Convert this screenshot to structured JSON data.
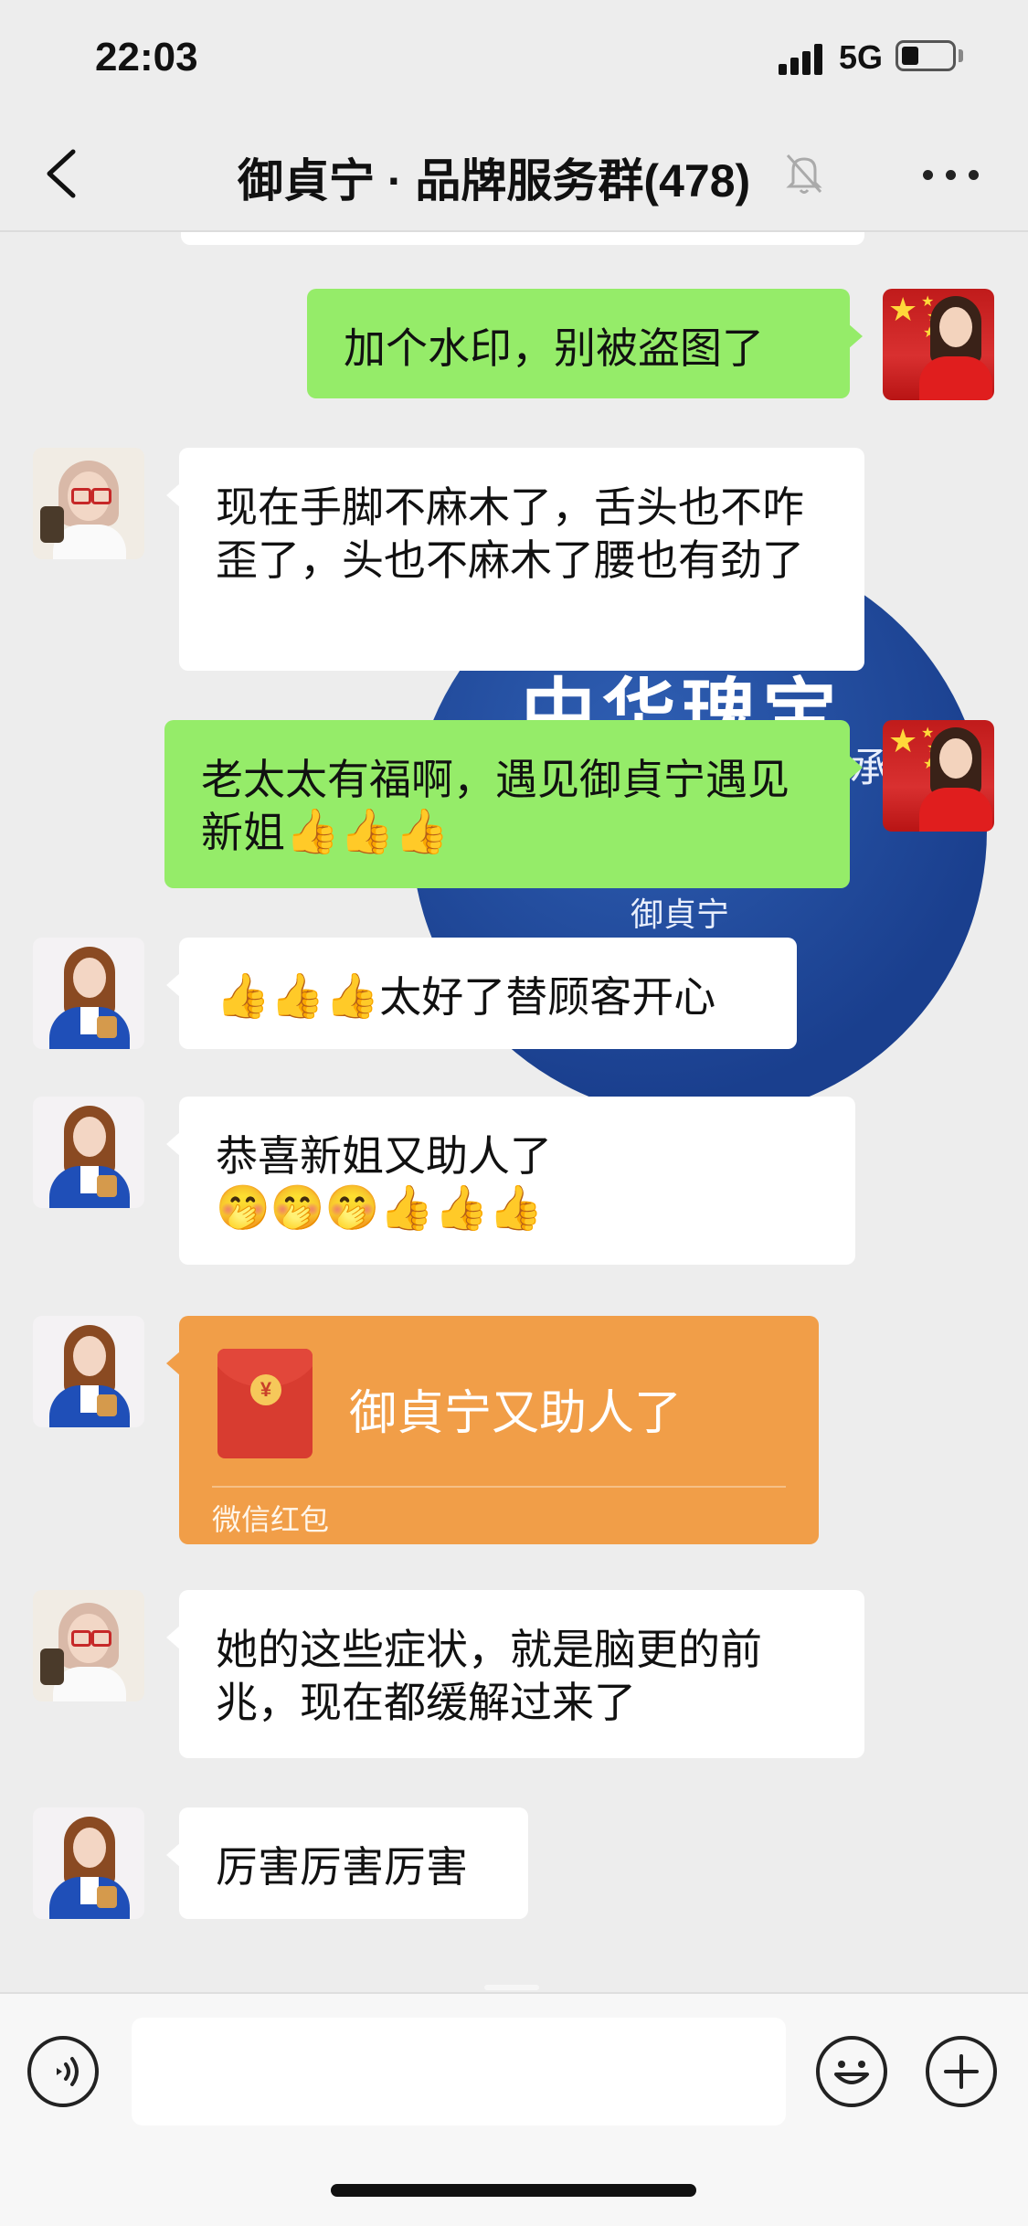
{
  "status_bar": {
    "time": "22:03",
    "network": "5G"
  },
  "nav": {
    "title": "御貞宁 · 品牌服务群(478)"
  },
  "background_image": {
    "line1": "中华瑰宝",
    "line2": "承",
    "line3": "御貞宁"
  },
  "messages": [
    {
      "side": "right",
      "avatar": "red-dress-woman",
      "text": "加个水印，别被盗图了"
    },
    {
      "side": "left",
      "avatar": "glasses-woman",
      "text": "现在手脚不麻木了，舌头也不咋歪了，头也不麻木了腰也有劲了"
    },
    {
      "side": "right",
      "avatar": "red-dress-woman",
      "text": "老太太有福啊，遇见御貞宁遇见新姐",
      "emojis": "👍👍👍"
    },
    {
      "side": "left",
      "avatar": "blue-suit-woman",
      "emojis": "👍👍👍",
      "text": "太好了替顾客开心"
    },
    {
      "side": "left",
      "avatar": "blue-suit-woman",
      "text": "恭喜新姐又助人了",
      "emojis": "🤭🤭🤭👍👍👍"
    },
    {
      "side": "left",
      "avatar": "blue-suit-woman",
      "type": "red_packet",
      "title": "御貞宁又助人了",
      "label": "微信红包",
      "coin": "¥"
    },
    {
      "side": "left",
      "avatar": "glasses-woman",
      "text": "她的这些症状，就是脑更的前兆，现在都缓解过来了"
    },
    {
      "side": "left",
      "avatar": "blue-suit-woman",
      "text": "厉害厉害厉害"
    }
  ],
  "input_bar": {
    "placeholder": ""
  },
  "icons": {
    "back": "chevron-left-icon",
    "mute": "bell-off-icon",
    "more": "more-horizontal-icon",
    "voice": "voice-icon",
    "emoji": "smile-icon",
    "plus": "plus-circle-icon"
  },
  "colors": {
    "green_bubble": "#95ec69",
    "red_packet": "#f19e48",
    "background": "#ededed"
  }
}
